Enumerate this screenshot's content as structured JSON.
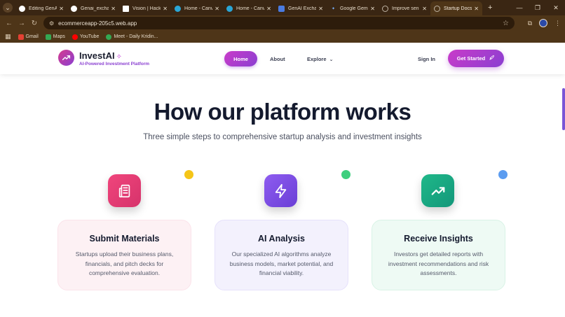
{
  "browser": {
    "tabs": [
      {
        "title": "Editing GenAI",
        "icon": "github-icon",
        "fav_color": "#ffffff"
      },
      {
        "title": "Genai_exchange",
        "icon": "github-icon",
        "fav_color": "#ffffff"
      },
      {
        "title": "Vision | Hack",
        "icon": "vision-icon",
        "fav_color": "#ffffff"
      },
      {
        "title": "Home - Canva",
        "icon": "canva-icon",
        "fav_color": "#2aa6d6"
      },
      {
        "title": "Home - Canva",
        "icon": "canva-icon",
        "fav_color": "#2aa6d6"
      },
      {
        "title": "GenAI Exchange",
        "icon": "genai-icon",
        "fav_color": "#4a7be0"
      },
      {
        "title": "Google Gemini",
        "icon": "gemini-icon",
        "fav_color": "#7ab3ff"
      },
      {
        "title": "Improve sen",
        "icon": "globe-icon",
        "fav_color": "#bfb3a3"
      },
      {
        "title": "Startup Docs",
        "icon": "globe-icon",
        "fav_color": "#bfb3a3",
        "active": true
      }
    ],
    "url": "ecommerceapp-205c5.web.app",
    "bookmarks": [
      {
        "label": "Gmail",
        "color": "#e34133"
      },
      {
        "label": "Maps",
        "color": "#34a853"
      },
      {
        "label": "YouTube",
        "color": "#ff0000"
      },
      {
        "label": "Meet - Daily Kridin...",
        "color": "#34a853"
      }
    ]
  },
  "header": {
    "brand": "InvestAI",
    "tagline": "AI-Powered Investment Platform",
    "nav": {
      "home": "Home",
      "about": "About",
      "explore": "Explore"
    },
    "sign_in": "Sign In",
    "get_started": "Get Started"
  },
  "hero": {
    "title": "How our platform works",
    "subtitle": "Three simple steps to comprehensive startup analysis and investment insights"
  },
  "steps": [
    {
      "title": "Submit Materials",
      "description": "Startups upload their business plans, financials, and pitch decks for comprehensive evaluation.",
      "icon": "document-icon",
      "icon_color": "#e33d73",
      "card_bg": "#fdf1f4",
      "dot_color": "#f5c518"
    },
    {
      "title": "AI Analysis",
      "description": "Our specialized AI algorithms analyze business models, market potential, and financial viability.",
      "icon": "lightning-icon",
      "icon_color": "#7a4fe0",
      "card_bg": "#f3f1fd",
      "dot_color": "#3ecf7e"
    },
    {
      "title": "Receive Insights",
      "description": "Investors get detailed reports with investment recommendations and risk assessments.",
      "icon": "trend-up-icon",
      "icon_color": "#17a37a",
      "card_bg": "#eefaf4",
      "dot_color": "#5b9cf0"
    }
  ]
}
